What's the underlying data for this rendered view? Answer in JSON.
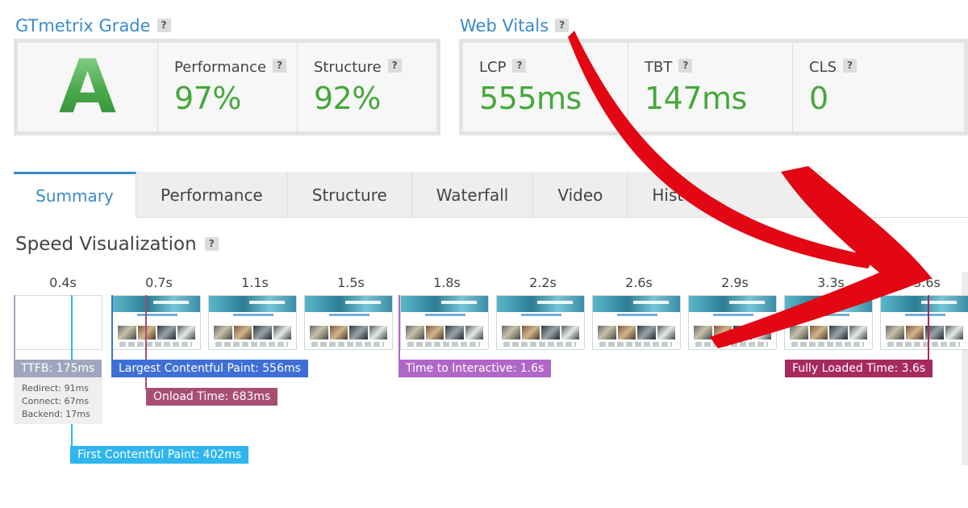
{
  "grade": {
    "title": "GTmetrix Grade",
    "help": "?",
    "letter": "A",
    "metrics": [
      {
        "label": "Performance",
        "value": "97%"
      },
      {
        "label": "Structure",
        "value": "92%"
      }
    ]
  },
  "vitals": {
    "title": "Web Vitals",
    "help": "?",
    "metrics": [
      {
        "label": "LCP",
        "value": "555ms"
      },
      {
        "label": "TBT",
        "value": "147ms"
      },
      {
        "label": "CLS",
        "value": "0"
      }
    ]
  },
  "tabs": [
    "Summary",
    "Performance",
    "Structure",
    "Waterfall",
    "Video",
    "Histo"
  ],
  "active_tab": "Summary",
  "speed": {
    "title": "Speed Visualization",
    "help": "?",
    "ticks": [
      "0.4s",
      "0.7s",
      "1.1s",
      "1.5s",
      "1.8s",
      "2.2s",
      "2.6s",
      "2.9s",
      "3.3s",
      "3.6s"
    ],
    "markers": {
      "ttfb": "TTFB: 175ms",
      "lcp": "Largest Contentful Paint: 556ms",
      "onload": "Onload Time: 683ms",
      "tti": "Time to Interactive: 1.6s",
      "fully": "Fully Loaded Time: 3.6s",
      "fcp": "First Contentful Paint: 402ms"
    },
    "ttfb_details": {
      "redirect": "Redirect: 91ms",
      "connect": "Connect: 67ms",
      "backend": "Backend: 17ms"
    }
  },
  "colors": {
    "accent_blue": "#3a8bc7",
    "grade_green": "#44a83a",
    "arrow_red": "#e30613"
  }
}
